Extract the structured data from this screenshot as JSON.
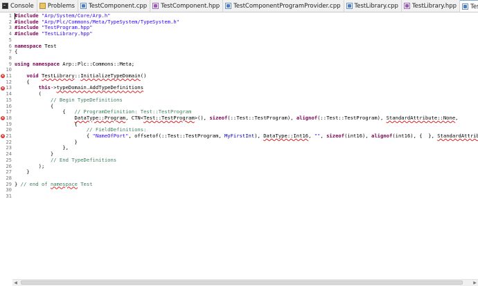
{
  "tabs": [
    {
      "label": "Console",
      "icon": "console-icon",
      "type": "console"
    },
    {
      "label": "Problems",
      "icon": "problems-icon",
      "type": "problems"
    },
    {
      "label": "TestComponent.cpp",
      "icon": "cpp-file-icon",
      "type": "cpp"
    },
    {
      "label": "TestComponent.hpp",
      "icon": "hpp-file-icon",
      "type": "hpp"
    },
    {
      "label": "TestComponentProgramProvider.cpp",
      "icon": "cpp-file-icon",
      "type": "cpp"
    },
    {
      "label": "TestLibrary.cpp",
      "icon": "cpp-file-icon",
      "type": "cpp"
    },
    {
      "label": "TestLibrary.hpp",
      "icon": "hpp-file-icon",
      "type": "hpp"
    },
    {
      "label": "TestLibrary.meta.cpp",
      "icon": "cpp-file-icon",
      "type": "cpp",
      "active": true,
      "close": "×"
    }
  ],
  "error_lines": [
    11,
    13,
    18,
    21
  ],
  "code_lines": [
    [
      {
        "t": "#include ",
        "c": "kw"
      },
      {
        "t": "\"Arp/System/Core/Arp.h\"",
        "c": "str"
      }
    ],
    [
      {
        "t": "#include ",
        "c": "kw"
      },
      {
        "t": "\"Arp/Plc/Commons/Meta/TypeSystem/TypeSystem.h\"",
        "c": "str"
      }
    ],
    [
      {
        "t": "#include ",
        "c": "kw"
      },
      {
        "t": "\"TestProgram.hpp\"",
        "c": "str"
      }
    ],
    [
      {
        "t": "#include ",
        "c": "kw"
      },
      {
        "t": "\"TestLibrary.hpp\"",
        "c": "str"
      }
    ],
    [],
    [
      {
        "t": "namespace ",
        "c": "kw"
      },
      {
        "t": "Test"
      }
    ],
    [
      {
        "t": "{"
      }
    ],
    [],
    [
      {
        "t": "using namespace ",
        "c": "kw"
      },
      {
        "t": "Arp::Plc::Commons::Meta;"
      }
    ],
    [],
    [
      {
        "t": "    "
      },
      {
        "t": "void ",
        "c": "kw"
      },
      {
        "t": "TestLibrary",
        "c": "sq"
      },
      {
        "t": "::"
      },
      {
        "t": "InitializeTypeDomain",
        "c": "sq"
      },
      {
        "t": "()"
      }
    ],
    [
      {
        "t": "    {"
      }
    ],
    [
      {
        "t": "        "
      },
      {
        "t": "this",
        "c": "kw"
      },
      {
        "t": "->"
      },
      {
        "t": "typeDomain.AddTypeDefinitions",
        "c": "sq"
      }
    ],
    [
      {
        "t": "        ("
      }
    ],
    [
      {
        "t": "            "
      },
      {
        "t": "// Begin TypeDefinitions",
        "c": "cmt"
      }
    ],
    [
      {
        "t": "            {"
      }
    ],
    [
      {
        "t": "                {   "
      },
      {
        "t": "// ProgramDefinition: Test::TestProgram",
        "c": "cmt"
      }
    ],
    [
      {
        "t": "                    "
      },
      {
        "t": "DataType::Program",
        "c": "sq"
      },
      {
        "t": ", CTN<"
      },
      {
        "t": "Test::TestProgram",
        "c": "sq"
      },
      {
        "t": ">(), "
      },
      {
        "t": "sizeof",
        "c": "kw"
      },
      {
        "t": "(::Test::TestProgram), "
      },
      {
        "t": "alignof",
        "c": "kw"
      },
      {
        "t": "(::Test::TestProgram), "
      },
      {
        "t": "StandardAttribute::None",
        "c": "sq"
      },
      {
        "t": ","
      }
    ],
    [
      {
        "t": "                    {"
      }
    ],
    [
      {
        "t": "                        "
      },
      {
        "t": "// FieldDefinitions:",
        "c": "cmt"
      }
    ],
    [
      {
        "t": "                        { "
      },
      {
        "t": "\"NameOfPort\"",
        "c": "str"
      },
      {
        "t": ", offsetof(::Test::TestProgram, "
      },
      {
        "t": "MyFirstInt",
        "c": "fld"
      },
      {
        "t": "), "
      },
      {
        "t": "DataType::Int16",
        "c": "sq"
      },
      {
        "t": ", "
      },
      {
        "t": "\"\"",
        "c": "str"
      },
      {
        "t": ", "
      },
      {
        "t": "sizeof",
        "c": "kw"
      },
      {
        "t": "(int16), "
      },
      {
        "t": "alignof",
        "c": "kw"
      },
      {
        "t": "(int16), {  }, "
      },
      {
        "t": "StandardAttribute::Input",
        "c": "sq"
      },
      {
        "t": " |"
      }
    ],
    [
      {
        "t": "                    }"
      }
    ],
    [
      {
        "t": "                },"
      }
    ],
    [
      {
        "t": "            }"
      }
    ],
    [
      {
        "t": "            "
      },
      {
        "t": "// End TypeDefinitions",
        "c": "cmt"
      }
    ],
    [
      {
        "t": "        );"
      }
    ],
    [
      {
        "t": "    }"
      }
    ],
    [],
    [
      {
        "t": "} "
      },
      {
        "t": "// end of ",
        "c": "cmt"
      },
      {
        "t": "namespace",
        "c": "cmt sq"
      },
      {
        "t": " Test",
        "c": "cmt"
      }
    ],
    [],
    []
  ]
}
